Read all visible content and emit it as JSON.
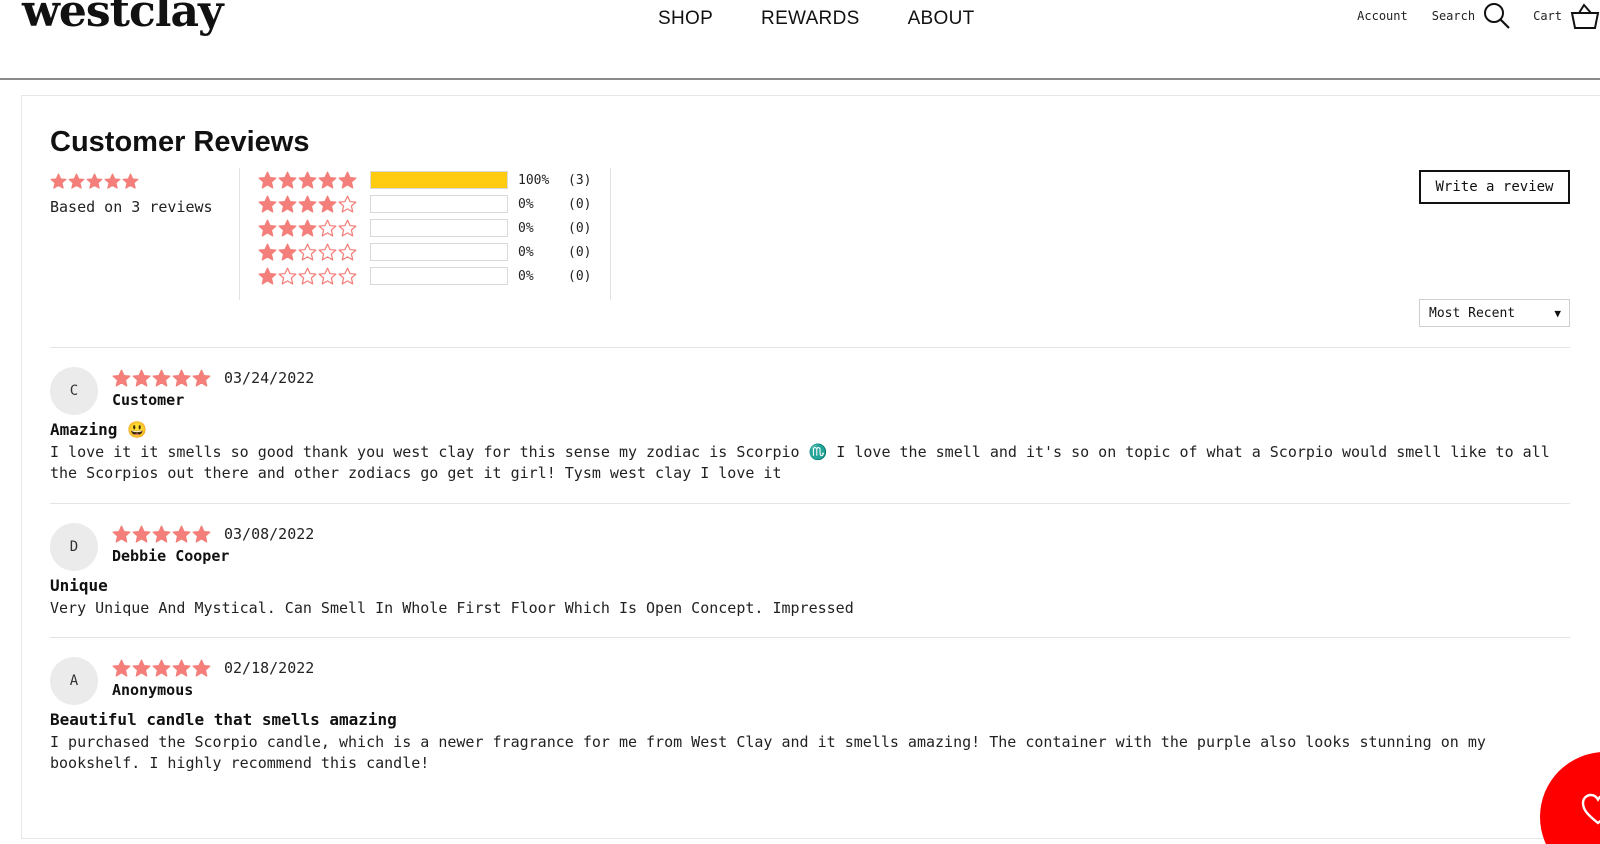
{
  "header": {
    "logo": "westclay",
    "nav": [
      "SHOP",
      "REWARDS",
      "ABOUT"
    ],
    "account": "Account",
    "search": "Search",
    "cart": "Cart"
  },
  "reviews": {
    "title": "Customer Reviews",
    "summary_stars": 5,
    "based_on": "Based on 3 reviews",
    "histogram": [
      {
        "stars": 5,
        "fraction": 1.0,
        "pct": "100%",
        "count": "(3)"
      },
      {
        "stars": 4,
        "fraction": 0,
        "pct": "0%",
        "count": "(0)"
      },
      {
        "stars": 3,
        "fraction": 0,
        "pct": "0%",
        "count": "(0)"
      },
      {
        "stars": 2,
        "fraction": 0,
        "pct": "0%",
        "count": "(0)"
      },
      {
        "stars": 1,
        "fraction": 0,
        "pct": "0%",
        "count": "(0)"
      }
    ],
    "write_review_label": "Write a review",
    "sort_selected": "Most Recent",
    "items": [
      {
        "initial": "C",
        "rating": 5,
        "date": "03/24/2022",
        "author": "Customer",
        "title": "Amazing 😃",
        "body": "I love it it smells so good thank you west clay for this sense my zodiac is Scorpio ♏️ I love the smell and it's so on topic of what a Scorpio would smell like to all the Scorpios out there and other zodiacs go get it girl! Tysm west clay I love it"
      },
      {
        "initial": "D",
        "rating": 5,
        "date": "03/08/2022",
        "author": "Debbie Cooper",
        "title": "Unique",
        "body": "Very Unique And Mystical. Can Smell In Whole First Floor Which Is Open Concept. Impressed"
      },
      {
        "initial": "A",
        "rating": 5,
        "date": "02/18/2022",
        "author": "Anonymous",
        "title": "Beautiful candle that smells amazing",
        "body": "I purchased the Scorpio candle, which is a newer fragrance for me from West Clay and it smells amazing! The container with the purple also looks stunning on my bookshelf. I highly recommend this candle!"
      }
    ]
  },
  "colors": {
    "star": "#f47f7a",
    "bar_fill": "#ffcc11",
    "fab": "#ff0000"
  }
}
